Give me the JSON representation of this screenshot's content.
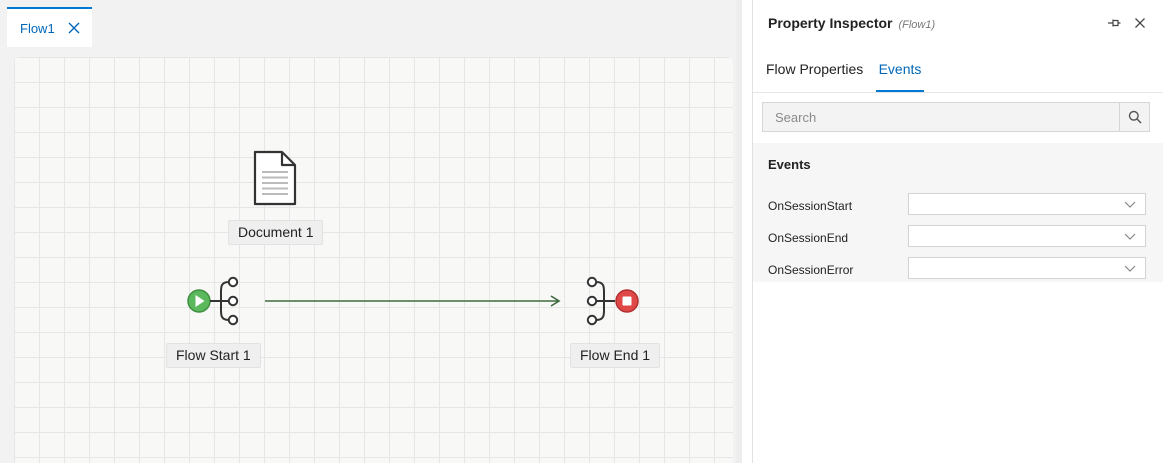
{
  "tabs": [
    {
      "label": "Flow1"
    }
  ],
  "canvas": {
    "nodes": [
      {
        "label": "Document 1",
        "type": "document"
      },
      {
        "label": "Flow Start 1",
        "type": "flow-start"
      },
      {
        "label": "Flow End 1",
        "type": "flow-end"
      }
    ],
    "connector_color": "#3d6b3d"
  },
  "inspector": {
    "title": "Property Inspector",
    "subtitle": "(Flow1)",
    "tabs": [
      {
        "label": "Flow Properties",
        "active": false
      },
      {
        "label": "Events",
        "active": true
      }
    ],
    "search": {
      "placeholder": "Search",
      "value": ""
    },
    "section_title": "Events",
    "properties": [
      {
        "label": "OnSessionStart",
        "value": ""
      },
      {
        "label": "OnSessionEnd",
        "value": ""
      },
      {
        "label": "OnSessionError",
        "value": ""
      }
    ]
  },
  "colors": {
    "accent": "#0078d4",
    "start_green": "#5cb85c",
    "end_red": "#e04848"
  },
  "icons": [
    "close-icon",
    "document-icon",
    "play-icon",
    "stop-icon",
    "pin-icon",
    "search-icon",
    "chevron-down-icon"
  ]
}
